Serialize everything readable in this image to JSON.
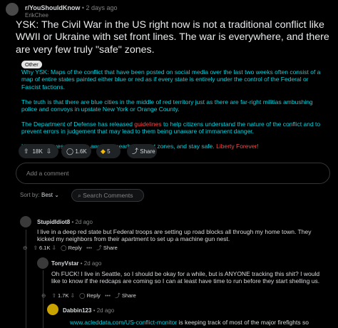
{
  "post": {
    "subreddit": "r/YouShouldKnow",
    "time": "2 days ago",
    "author": "ErikChee",
    "title": "YSK: The Civil War in the US right now is not a traditional conflict like WWII or Ukraine with set front lines. The war is everywhere, and there are very few truly \"safe\" zones.",
    "flair": "Other",
    "body": {
      "p1": "Why YSK: Maps of the conflict that have been posted on social media over the last two weeks often consist of a map of entire states painted either blue or red as if every state is entirely under the control of the Federal or Fascist factions.",
      "p2": "The truth is that there are blue cities in the middle of red territory just as there are far-right militias ambushing police and convoys in upstate New York or Orange County.",
      "p3_a": "The Department of Defense has released ",
      "p3_link": "guidelines",
      "p3_b": " to help citizens understand the nature of the conflict and to prevent errors in judgement that may lead to them being unaware of immanent danger.",
      "p4_a": "Keep your eyes open, be aware of nearby combat zones, and stay safe. ",
      "p4_link": "Liberty Forever!"
    },
    "votes": "18K",
    "comments": "1.6K",
    "awards": "5",
    "share": "Share"
  },
  "add_comment_placeholder": "Add a comment",
  "sort": {
    "label": "Sort by:",
    "value": "Best",
    "search_placeholder": "Search Comments"
  },
  "comments": [
    {
      "user": "StupidIdiot8",
      "time": "2d ago",
      "text": "I live in a deep red state but Federal troops are setting up road blocks all through my home town. They kicked my neighbors from their apartment to set up a machine gun nest.",
      "votes": "6.1K",
      "reply": "Reply",
      "share": "Share"
    },
    {
      "user": "TonyVstar",
      "time": "2d ago",
      "text": "Oh FUCK! I live in Seattle, so I should be okay for a while, but is ANYONE tracking this shit? I would like to know if the redcaps are coming so I can at least have time to run before they start shelling us.",
      "votes": "1.7K",
      "reply": "Reply",
      "share": "Share"
    },
    {
      "user": "Dabbin123",
      "time": "2d ago",
      "link": "www.acleddata.com/US-conflict-monitor",
      "text": " is keeping track of most of the major firefights so"
    }
  ],
  "colors": {
    "background": "#000000",
    "body_text": "#00d4e0",
    "link_red": "#ff4545",
    "pill": "#1f2326"
  }
}
